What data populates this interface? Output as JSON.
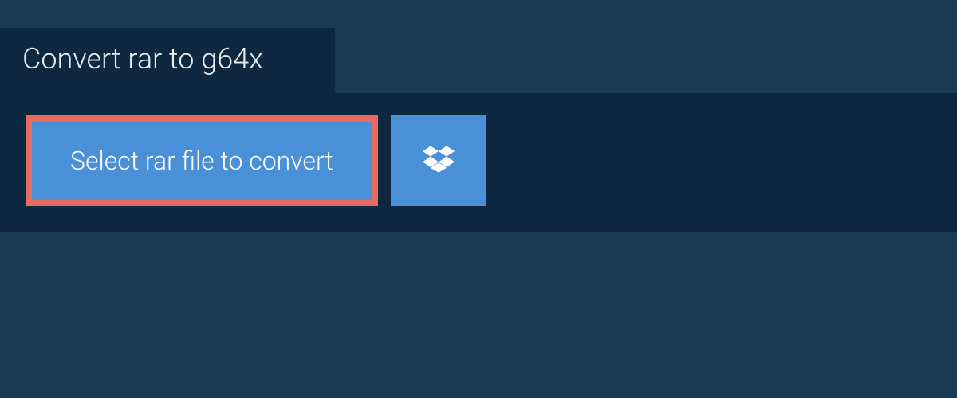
{
  "header": {
    "tab_label": "Convert rar to g64x"
  },
  "main": {
    "select_button_label": "Select rar file to convert"
  },
  "colors": {
    "page_bg": "#1a3a52",
    "panel_bg": "#0d2840",
    "button_bg": "#4a90d9",
    "highlight_border": "#e76b5f",
    "text_light": "#ffffff",
    "header_text": "#e8eef2"
  }
}
